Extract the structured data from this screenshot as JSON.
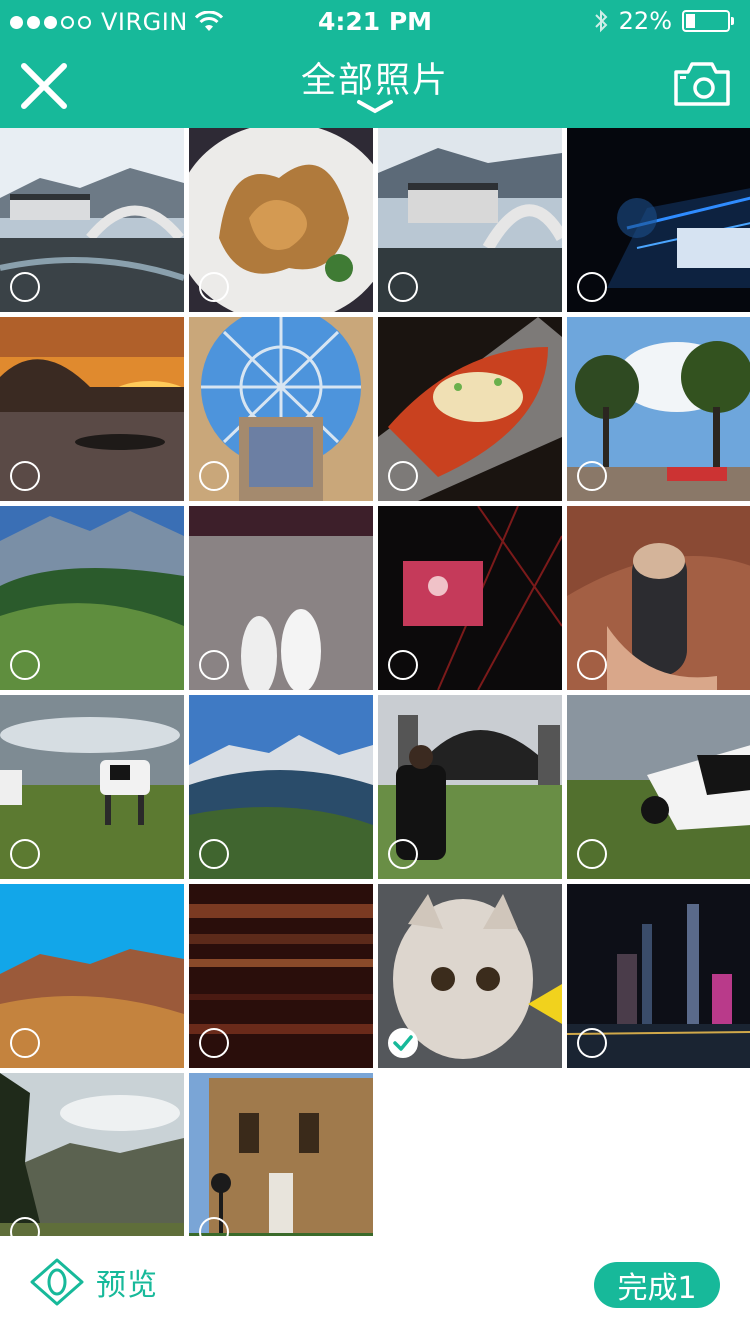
{
  "status_bar": {
    "carrier": "VIRGIN",
    "time": "4:21 PM",
    "battery": "22%",
    "battery_level": 0.22
  },
  "nav": {
    "title": "全部照片",
    "close_icon": "close-icon",
    "title_dropdown_icon": "chevron-down-icon",
    "camera_icon": "camera-icon"
  },
  "colors": {
    "accent": "#17b99a"
  },
  "photos": [
    {
      "subject": "ancient town bridge",
      "selected": false
    },
    {
      "subject": "fried food plate",
      "selected": false
    },
    {
      "subject": "ancient town bridge",
      "selected": false
    },
    {
      "subject": "concert stage",
      "selected": false
    },
    {
      "subject": "sunset lake",
      "selected": false
    },
    {
      "subject": "glass dome",
      "selected": false
    },
    {
      "subject": "fish dish",
      "selected": false
    },
    {
      "subject": "trees sky",
      "selected": false
    },
    {
      "subject": "green mountains",
      "selected": false
    },
    {
      "subject": "white shoes",
      "selected": false
    },
    {
      "subject": "concert screen",
      "selected": false
    },
    {
      "subject": "hand holding bottle",
      "selected": false
    },
    {
      "subject": "cows grassland",
      "selected": false
    },
    {
      "subject": "blue mountains",
      "selected": false
    },
    {
      "subject": "music festival",
      "selected": false
    },
    {
      "subject": "cow grazing",
      "selected": false
    },
    {
      "subject": "desert mountains",
      "selected": false
    },
    {
      "subject": "red wood",
      "selected": false
    },
    {
      "subject": "white kitten",
      "selected": true
    },
    {
      "subject": "city night",
      "selected": false
    },
    {
      "subject": "hills and tree",
      "selected": false
    },
    {
      "subject": "church facade",
      "selected": false
    }
  ],
  "bottom_bar": {
    "preview_label": "预览",
    "preview_icon": "eye-icon",
    "done_label": "完成1"
  }
}
